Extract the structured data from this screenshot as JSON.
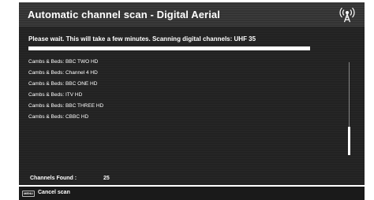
{
  "window": {
    "title": "Automatic channel scan - Digital Aerial",
    "icon": "antenna-signal-icon"
  },
  "scan": {
    "status": "Please wait. This will take a few minutes. Scanning digital channels: UHF 35",
    "progress_percent": 100
  },
  "channels": [
    {
      "label": "Cambs & Beds: BBC TWO HD"
    },
    {
      "label": "Cambs & Beds: Channel 4 HD"
    },
    {
      "label": "Cambs & Beds: BBC ONE HD"
    },
    {
      "label": "Cambs & Beds: ITV HD"
    },
    {
      "label": "Cambs & Beds: BBC THREE HD"
    },
    {
      "label": "Cambs & Beds: CBBC  HD"
    }
  ],
  "summary": {
    "found_label": "Channels Found :",
    "found_count": "25"
  },
  "footer": {
    "key_label": "MENU",
    "action_label": "Cancel scan"
  },
  "colors": {
    "background": "#222222",
    "title_bar": "#333333",
    "text": "#ffffff"
  }
}
